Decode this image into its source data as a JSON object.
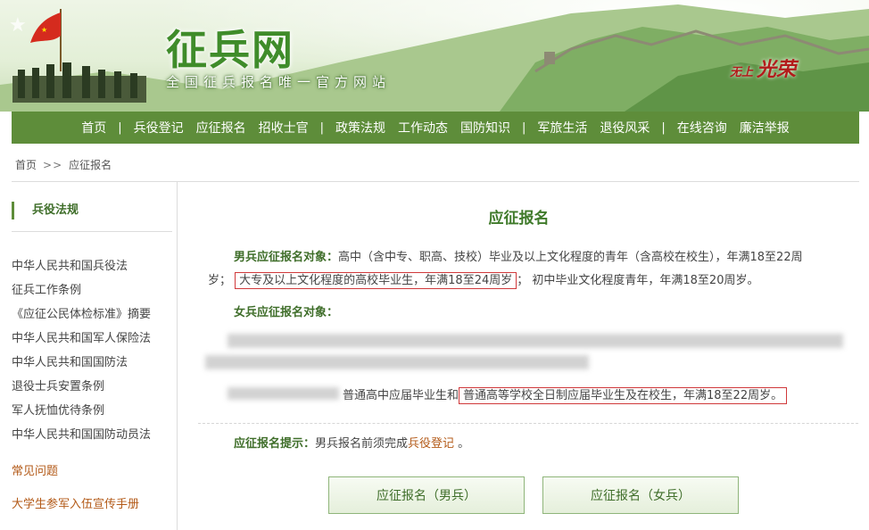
{
  "banner": {
    "site_title": "征兵网",
    "subtitle": "全国征兵报名唯一官方网站",
    "slogan_small": "无上",
    "slogan_big": "光荣"
  },
  "nav": {
    "items": [
      "首页",
      "兵役登记",
      "应征报名",
      "招收士官",
      "政策法规",
      "工作动态",
      "国防知识",
      "军旅生活",
      "退役风采",
      "在线咨询",
      "廉洁举报"
    ],
    "separator": "|"
  },
  "breadcrumb": {
    "home": "首页",
    "arrow": ">>",
    "current": "应征报名"
  },
  "sidebar": {
    "heading": "兵役法规",
    "links": [
      "中华人民共和国兵役法",
      "征兵工作条例",
      "《应征公民体检标准》摘要",
      "中华人民共和国军人保险法",
      "中华人民共和国国防法",
      "退役士兵安置条例",
      "军人抚恤优待条例",
      "中华人民共和国国防动员法"
    ],
    "faq": "常见问题",
    "handbook": "大学生参军入伍宣传手册"
  },
  "main": {
    "title": "应征报名",
    "male": {
      "label": "男兵应征报名对象：",
      "line1_rest": "高中（含中专、职高、技校）毕业及以上文化程度的青年（含高校在校生），年满18至22周",
      "line2_prefix": "岁；",
      "line2_boxed": "大专及以上文化程度的高校毕业生，年满18至24周岁",
      "line2_suffix": "；  初中毕业文化程度青年，年满18至20周岁。"
    },
    "female": {
      "label": "女兵应征报名对象：",
      "line_plain": "普通高中应届毕业生和",
      "line_boxed": "普通高等学校全日制应届毕业生及在校生，年满18至22周岁。"
    },
    "tip": {
      "label": "应征报名提示：",
      "text": "男兵报名前须完成",
      "link": "兵役登记",
      "end": " 。"
    },
    "buttons": {
      "male": "应征报名（男兵）",
      "female": "应征报名（女兵）"
    }
  },
  "colors": {
    "nav_bg": "#5e8d3a",
    "accent_green": "#3f7a2a",
    "highlight_box": "#d0393b",
    "link_orange": "#b35a18"
  }
}
